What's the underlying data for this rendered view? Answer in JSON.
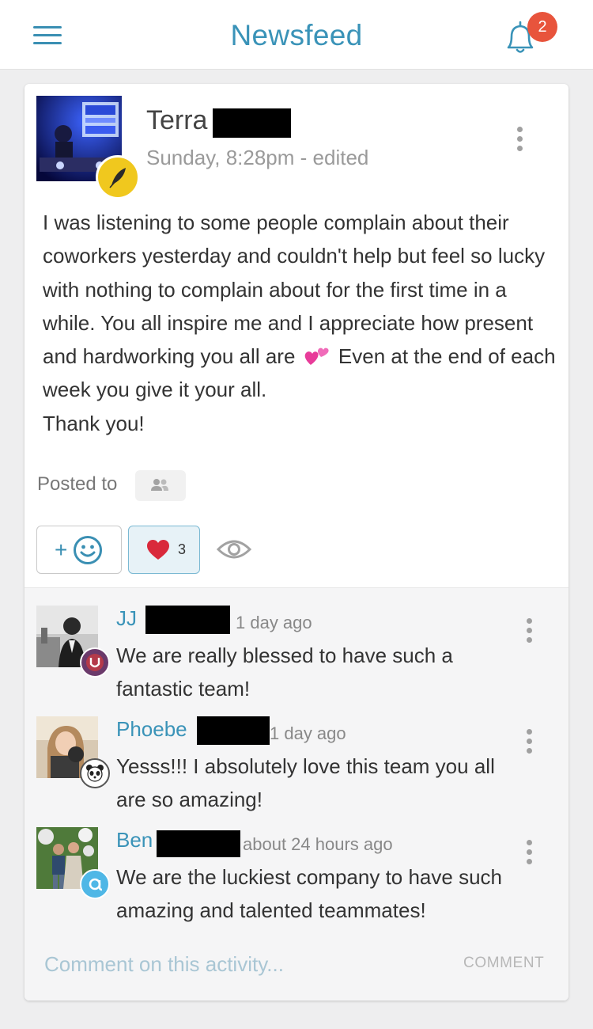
{
  "header": {
    "title": "Newsfeed",
    "notification_count": "2",
    "icons": {
      "menu": "hamburger-icon",
      "bell": "bell-icon"
    }
  },
  "post": {
    "author_first_name": "Terra",
    "timestamp": "Sunday, 8:28pm - edited",
    "body_part1": "I was listening to some people complain about their coworkers yesterday and couldn't help but feel so lucky with nothing to complain about for the first time in a while. You all inspire me and I appreciate how present and hardworking you all are",
    "body_emoji": "two-hearts-emoji",
    "body_part2": "Even at the end of each week you give it your all.",
    "body_part3": "Thank you!",
    "posted_to_label": "Posted to",
    "reactions": {
      "add_plus": "+",
      "heart_count": "3"
    },
    "icons": {
      "author_badge": "feather-badge-icon",
      "audience": "people-icon",
      "views": "eye-icon",
      "add_reaction": "smiley-icon",
      "heart": "heart-icon"
    }
  },
  "comments": [
    {
      "name": "JJ",
      "time": "1 day ago",
      "text": "We are really blessed to have such a fantastic team!",
      "badge": "purple-award-badge-icon"
    },
    {
      "name": "Phoebe",
      "time": "1 day ago",
      "text": "Yesss!!! I absolutely love this team you all are so amazing!",
      "badge": "panda-badge-icon"
    },
    {
      "name": "Ben",
      "time": "about 24 hours ago",
      "text": "We are the luckiest company to have such amazing and talented teammates!",
      "badge": "blue-badge-icon"
    }
  ],
  "composer": {
    "placeholder": "Comment on this activity...",
    "submit_label": "COMMENT"
  },
  "colors": {
    "accent": "#3a93b8",
    "badge_red": "#e8543c",
    "heart": "#d9293b",
    "card_bg": "#ffffff",
    "page_bg": "#eeeeef"
  }
}
